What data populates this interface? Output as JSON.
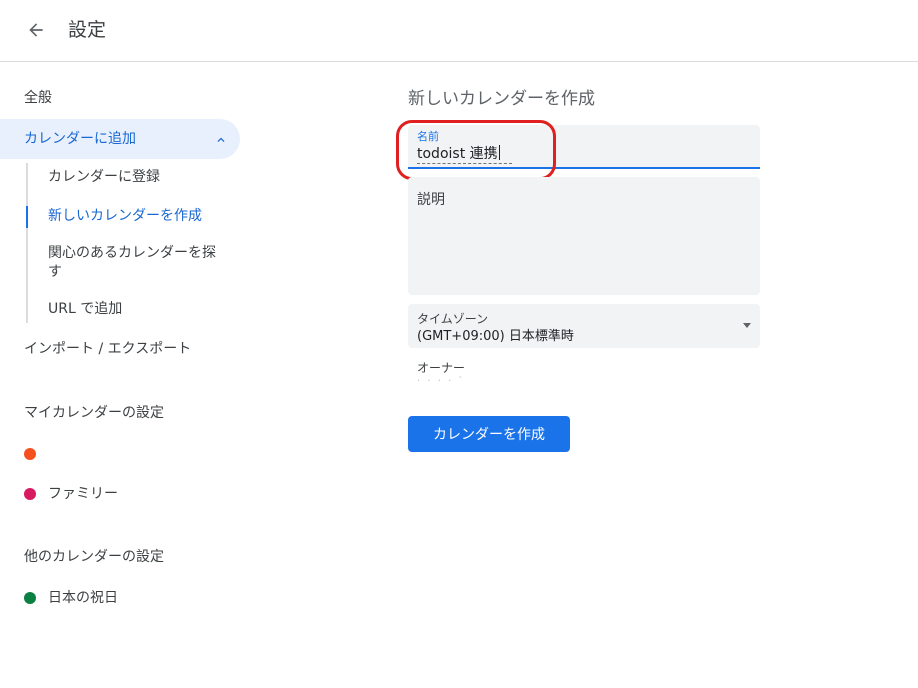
{
  "header": {
    "title": "設定",
    "back_icon": "arrow-left-icon"
  },
  "sidebar": {
    "general": "全般",
    "add_calendar": {
      "label": "カレンダーに追加",
      "expanded": true,
      "chevron_icon": "chevron-up-icon"
    },
    "add_calendar_subitems": [
      {
        "label": "カレンダーに登録",
        "active": false
      },
      {
        "label": "新しいカレンダーを作成",
        "active": true
      },
      {
        "label": "関心のあるカレンダーを探す",
        "active": false
      },
      {
        "label": "URL で追加",
        "active": false
      }
    ],
    "import_export": "インポート / エクスポート",
    "my_calendars": {
      "heading": "マイカレンダーの設定",
      "items": [
        {
          "name": "",
          "color": "#f4511e"
        },
        {
          "name": "ファミリー",
          "color": "#d81b60"
        }
      ]
    },
    "other_calendars": {
      "heading": "他のカレンダーの設定",
      "items": [
        {
          "name": "日本の祝日",
          "color": "#0b8043"
        }
      ]
    }
  },
  "main": {
    "section_title": "新しいカレンダーを作成",
    "name_field": {
      "label": "名前",
      "value": "todoist 連携"
    },
    "description_field": {
      "placeholder": "説明"
    },
    "timezone_field": {
      "label": "タイムゾーン",
      "value": "(GMT+09:00) 日本標準時"
    },
    "owner": {
      "label": "オーナー",
      "value": "· · · · ` "
    },
    "create_button": "カレンダーを作成"
  },
  "colors": {
    "accent": "#1a73e8",
    "active_bg": "#e8f0fe",
    "highlight_ring": "#e02020"
  }
}
